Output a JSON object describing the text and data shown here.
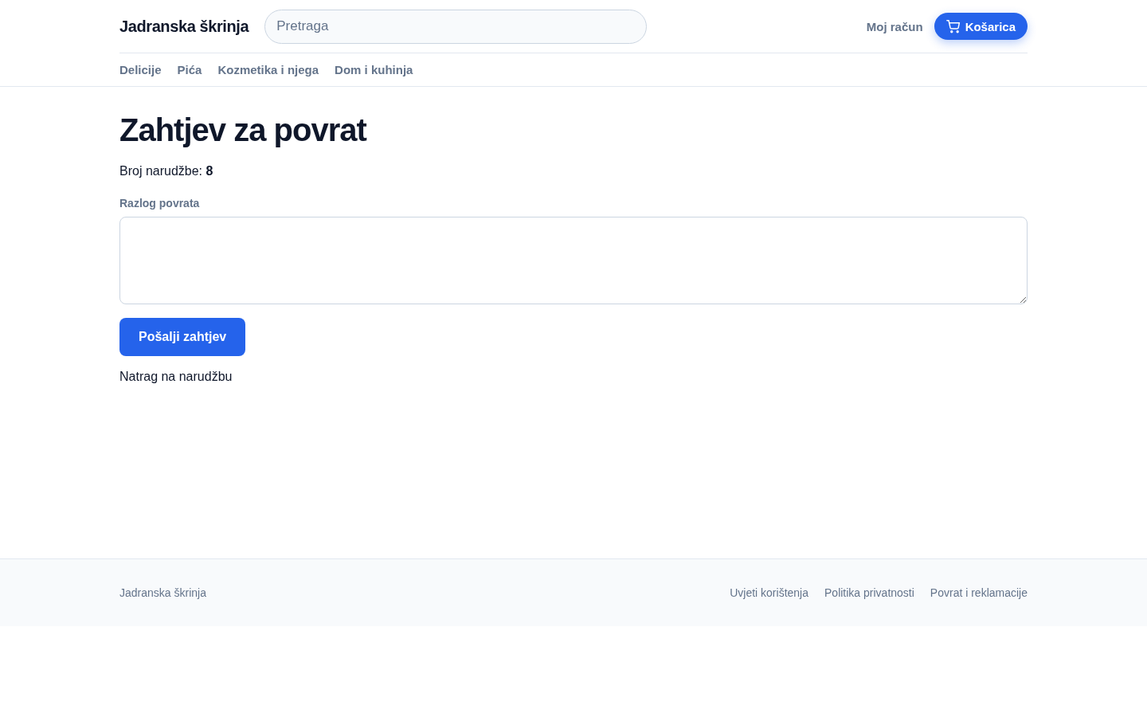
{
  "header": {
    "logo": "Jadranska škrinja",
    "search": {
      "placeholder": "Pretraga"
    },
    "account_link": "Moj račun",
    "cart_button": "Košarica"
  },
  "nav": [
    "Delicije",
    "Pića",
    "Kozmetika i njega",
    "Dom i kuhinja"
  ],
  "page": {
    "title": "Zahtjev za povrat",
    "order_line": "Broj narudžbe: **8**",
    "reason_field": {
      "label": "Razlog povrata"
    },
    "submit_button": "Pošalji zahtjev",
    "back_link": "Natrag na narudžbu"
  },
  "footer": {
    "brand": "Jadranska škrinja",
    "links": [
      "Uvjeti korištenja",
      "Politika privatnosti",
      "Povrat i reklamacije"
    ]
  }
}
